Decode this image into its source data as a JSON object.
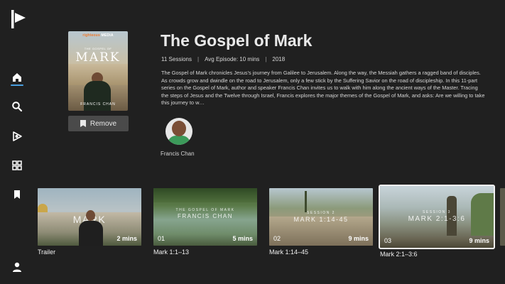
{
  "sidebar": {
    "items": [
      {
        "name": "home",
        "icon": "home-icon",
        "active": true
      },
      {
        "name": "search",
        "icon": "search-icon"
      },
      {
        "name": "channels",
        "icon": "channels-icon"
      },
      {
        "name": "browse",
        "icon": "grid-icon"
      },
      {
        "name": "saved",
        "icon": "bookmark-icon"
      },
      {
        "name": "profile",
        "icon": "user-icon"
      }
    ],
    "accent_color": "#4a9fe0"
  },
  "series": {
    "title": "The Gospel of Mark",
    "sessions": "11 Sessions",
    "avg_episode": "Avg Episode: 10 mins",
    "year": "2018",
    "description": "The Gospel of Mark chronicles Jesus's journey from Galilee to Jerusalem. Along the way, the Messiah gathers a ragged band of disciples. As crowds grow and dwindle on the road to Jerusalem, only a few stick by the Suffering Savior on the road of discipleship. In this 11-part series on the Gospel of Mark, author and speaker Francis Chan invites us to walk with him along the ancient ways of the Master. Tracing the steps of Jesus and the Twelve through Israel, Francis explores the major themes of the Gospel of Mark, and asks: Are we willing to take this journey to w…",
    "remove_label": "Remove",
    "cover": {
      "brand_a": "righteous",
      "brand_b": "MEDIA",
      "subtitle": "THE GOSPEL OF",
      "title": "MARK",
      "author": "FRANCIS CHAN"
    }
  },
  "author": {
    "name": "Francis Chan"
  },
  "episodes": [
    {
      "label": "Trailer",
      "number": "",
      "duration": "2 mins",
      "overlay": "MARK",
      "overlay_sub": ""
    },
    {
      "label": "Mark 1:1–13",
      "number": "01",
      "duration": "5 mins",
      "overlay": "FRANCIS CHAN",
      "overlay_sub": "THE GOSPEL OF MARK"
    },
    {
      "label": "Mark 1:14–45",
      "number": "02",
      "duration": "9 mins",
      "overlay": "MARK 1:14-45",
      "overlay_sub": "SESSION 2"
    },
    {
      "label": "Mark 2:1–3:6",
      "number": "03",
      "duration": "9 mins",
      "overlay": "MARK 2:1-3:6",
      "overlay_sub": "SESSION 3"
    }
  ]
}
